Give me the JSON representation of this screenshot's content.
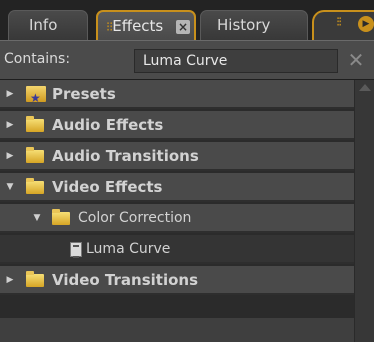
{
  "tabs": {
    "info_label": "Info",
    "effects_label": "Effects",
    "history_label": "History",
    "effects_close": "×",
    "grip": "⁝⁝",
    "menu_icon": "⁝⁝",
    "menu_arrow": "▶"
  },
  "search": {
    "label": "Contains:",
    "value": "Luma Curve",
    "clear": "✕"
  },
  "tree": {
    "items": [
      {
        "label": "Presets",
        "expanded": false,
        "icon": "preset-bin-icon"
      },
      {
        "label": "Audio Effects",
        "expanded": false,
        "icon": "folder-icon"
      },
      {
        "label": "Audio Transitions",
        "expanded": false,
        "icon": "folder-icon"
      },
      {
        "label": "Video Effects",
        "expanded": true,
        "icon": "folder-icon"
      },
      {
        "label": "Color Correction",
        "expanded": true,
        "icon": "folder-icon"
      },
      {
        "label": "Luma Curve",
        "icon": "effect-icon",
        "selected": true
      },
      {
        "label": "Video Transitions",
        "expanded": false,
        "icon": "folder-icon"
      }
    ],
    "collapsed_glyph": "▶",
    "expanded_glyph": "▼"
  },
  "colors": {
    "accent": "#c8901c",
    "panel": "#2b2b2b",
    "row": "#4a4a4a",
    "selected_row": "#343434"
  }
}
